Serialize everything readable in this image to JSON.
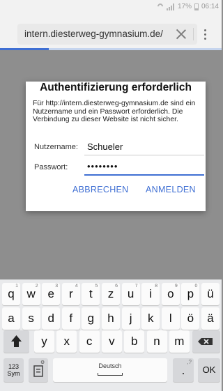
{
  "status_bar": {
    "battery_text": "17%",
    "time": "06:14"
  },
  "browser": {
    "url": "intern.diesterweg-gymnasium.de/",
    "progress": 0.22
  },
  "dialog": {
    "title": "Authentifizierung erforderlich",
    "message": "Für http://intern.diesterweg-gymnasium.de sind ein Nutzername und ein Passwort erforderlich. Die Verbindung zu dieser Website ist nicht sicher.",
    "username_label": "Nutzername:",
    "username_value": "Schueler",
    "password_label": "Passwort:",
    "password_value": "••••••••",
    "cancel_label": "ABBRECHEN",
    "login_label": "ANMELDEN"
  },
  "keyboard": {
    "row1": [
      {
        "char": "q",
        "hint": "1"
      },
      {
        "char": "w",
        "hint": "2"
      },
      {
        "char": "e",
        "hint": "3"
      },
      {
        "char": "r",
        "hint": "4"
      },
      {
        "char": "t",
        "hint": "5"
      },
      {
        "char": "z",
        "hint": "6"
      },
      {
        "char": "u",
        "hint": "7"
      },
      {
        "char": "i",
        "hint": "8"
      },
      {
        "char": "o",
        "hint": "9"
      },
      {
        "char": "p",
        "hint": "0"
      },
      {
        "char": "ü",
        "hint": ""
      }
    ],
    "row2": [
      "a",
      "s",
      "d",
      "f",
      "g",
      "h",
      "j",
      "k",
      "l",
      "ö",
      "ä"
    ],
    "row3": [
      "y",
      "x",
      "c",
      "v",
      "b",
      "n",
      "m"
    ],
    "symbols_label": "123 Sym",
    "space_label": "Deutsch",
    "period_label": ".",
    "period_hint": ",?",
    "ok_label": "OK"
  }
}
